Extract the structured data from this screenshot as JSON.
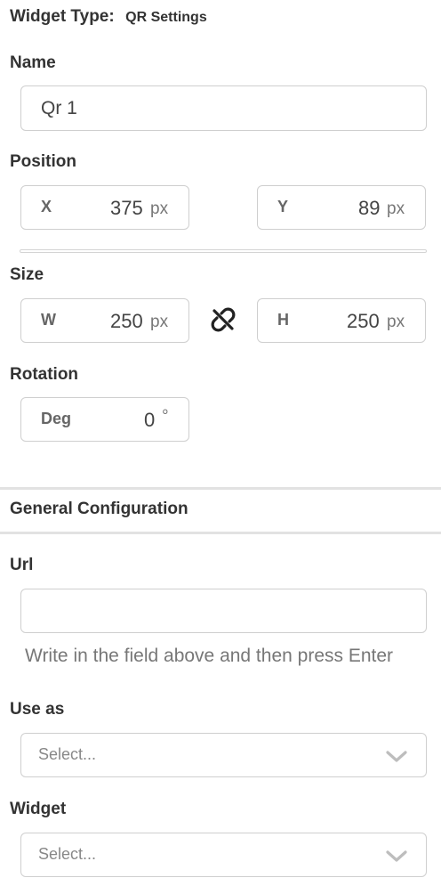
{
  "widget_type": {
    "label": "Widget Type:",
    "value": "QR Settings"
  },
  "name": {
    "label": "Name",
    "value": "Qr 1"
  },
  "position": {
    "label": "Position",
    "x": {
      "key": "X",
      "value": "375",
      "unit": "px"
    },
    "y": {
      "key": "Y",
      "value": "89",
      "unit": "px"
    }
  },
  "size": {
    "label": "Size",
    "w": {
      "key": "W",
      "value": "250",
      "unit": "px"
    },
    "h": {
      "key": "H",
      "value": "250",
      "unit": "px"
    },
    "link_icon": "unlink-icon"
  },
  "rotation": {
    "label": "Rotation",
    "key": "Deg",
    "value": "0",
    "unit": "°"
  },
  "general": {
    "title": "General Configuration",
    "url": {
      "label": "Url",
      "value": "",
      "help": "Write in the field above and then press Enter"
    },
    "use_as": {
      "label": "Use as",
      "placeholder": "Select..."
    },
    "widget": {
      "label": "Widget",
      "placeholder": "Select..."
    }
  }
}
